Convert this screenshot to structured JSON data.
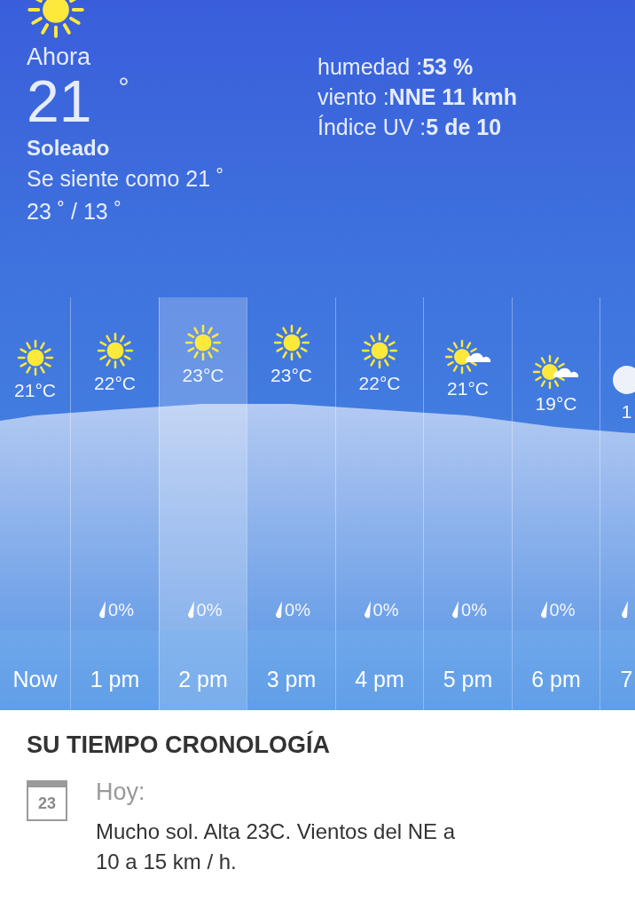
{
  "current": {
    "label": "Ahora",
    "temperature": "21",
    "degree": "°",
    "condition": "Soleado",
    "feels_like": "Se siente como 21 ˚",
    "high_low": "23 ˚ / 13 ˚"
  },
  "details": [
    {
      "label": "humedad :",
      "value": "53 %"
    },
    {
      "label": "viento :",
      "value": "NNE 11 kmh"
    },
    {
      "label": "Índice UV :",
      "value": "5 de 10"
    }
  ],
  "hourly": [
    {
      "time": "Now",
      "temperature": "21°C",
      "kind": "sun",
      "drop": false,
      "selected": false
    },
    {
      "time": "1 pm",
      "temperature": "22°C",
      "kind": "sun",
      "drop": true,
      "rain_chance": "0%",
      "selected": false
    },
    {
      "time": "2 pm",
      "temperature": "23°C",
      "kind": "sun",
      "drop": true,
      "rain_chance": "0%",
      "selected": true
    },
    {
      "time": "3 pm",
      "temperature": "23°C",
      "kind": "sun",
      "drop": true,
      "rain_chance": "0%",
      "selected": false
    },
    {
      "time": "4 pm",
      "temperature": "22°C",
      "kind": "sun",
      "drop": true,
      "rain_chance": "0%",
      "selected": false
    },
    {
      "time": "5 pm",
      "temperature": "21°C",
      "kind": "suncloud",
      "drop": true,
      "rain_chance": "0%",
      "selected": false
    },
    {
      "time": "6 pm",
      "temperature": "19°C",
      "kind": "suncloud",
      "drop": true,
      "rain_chance": "0%",
      "selected": false
    },
    {
      "time": "7",
      "temperature": "1",
      "kind": "disc",
      "drop": true,
      "selected": false
    }
  ],
  "timeline": {
    "title": "SU TIEMPO CRONOLOGÍA",
    "entries": [
      {
        "date": "23",
        "label": "Hoy:",
        "text": "Mucho sol. Alta 23C. Vientos del NE a 10 a 15 km / h."
      }
    ]
  }
}
